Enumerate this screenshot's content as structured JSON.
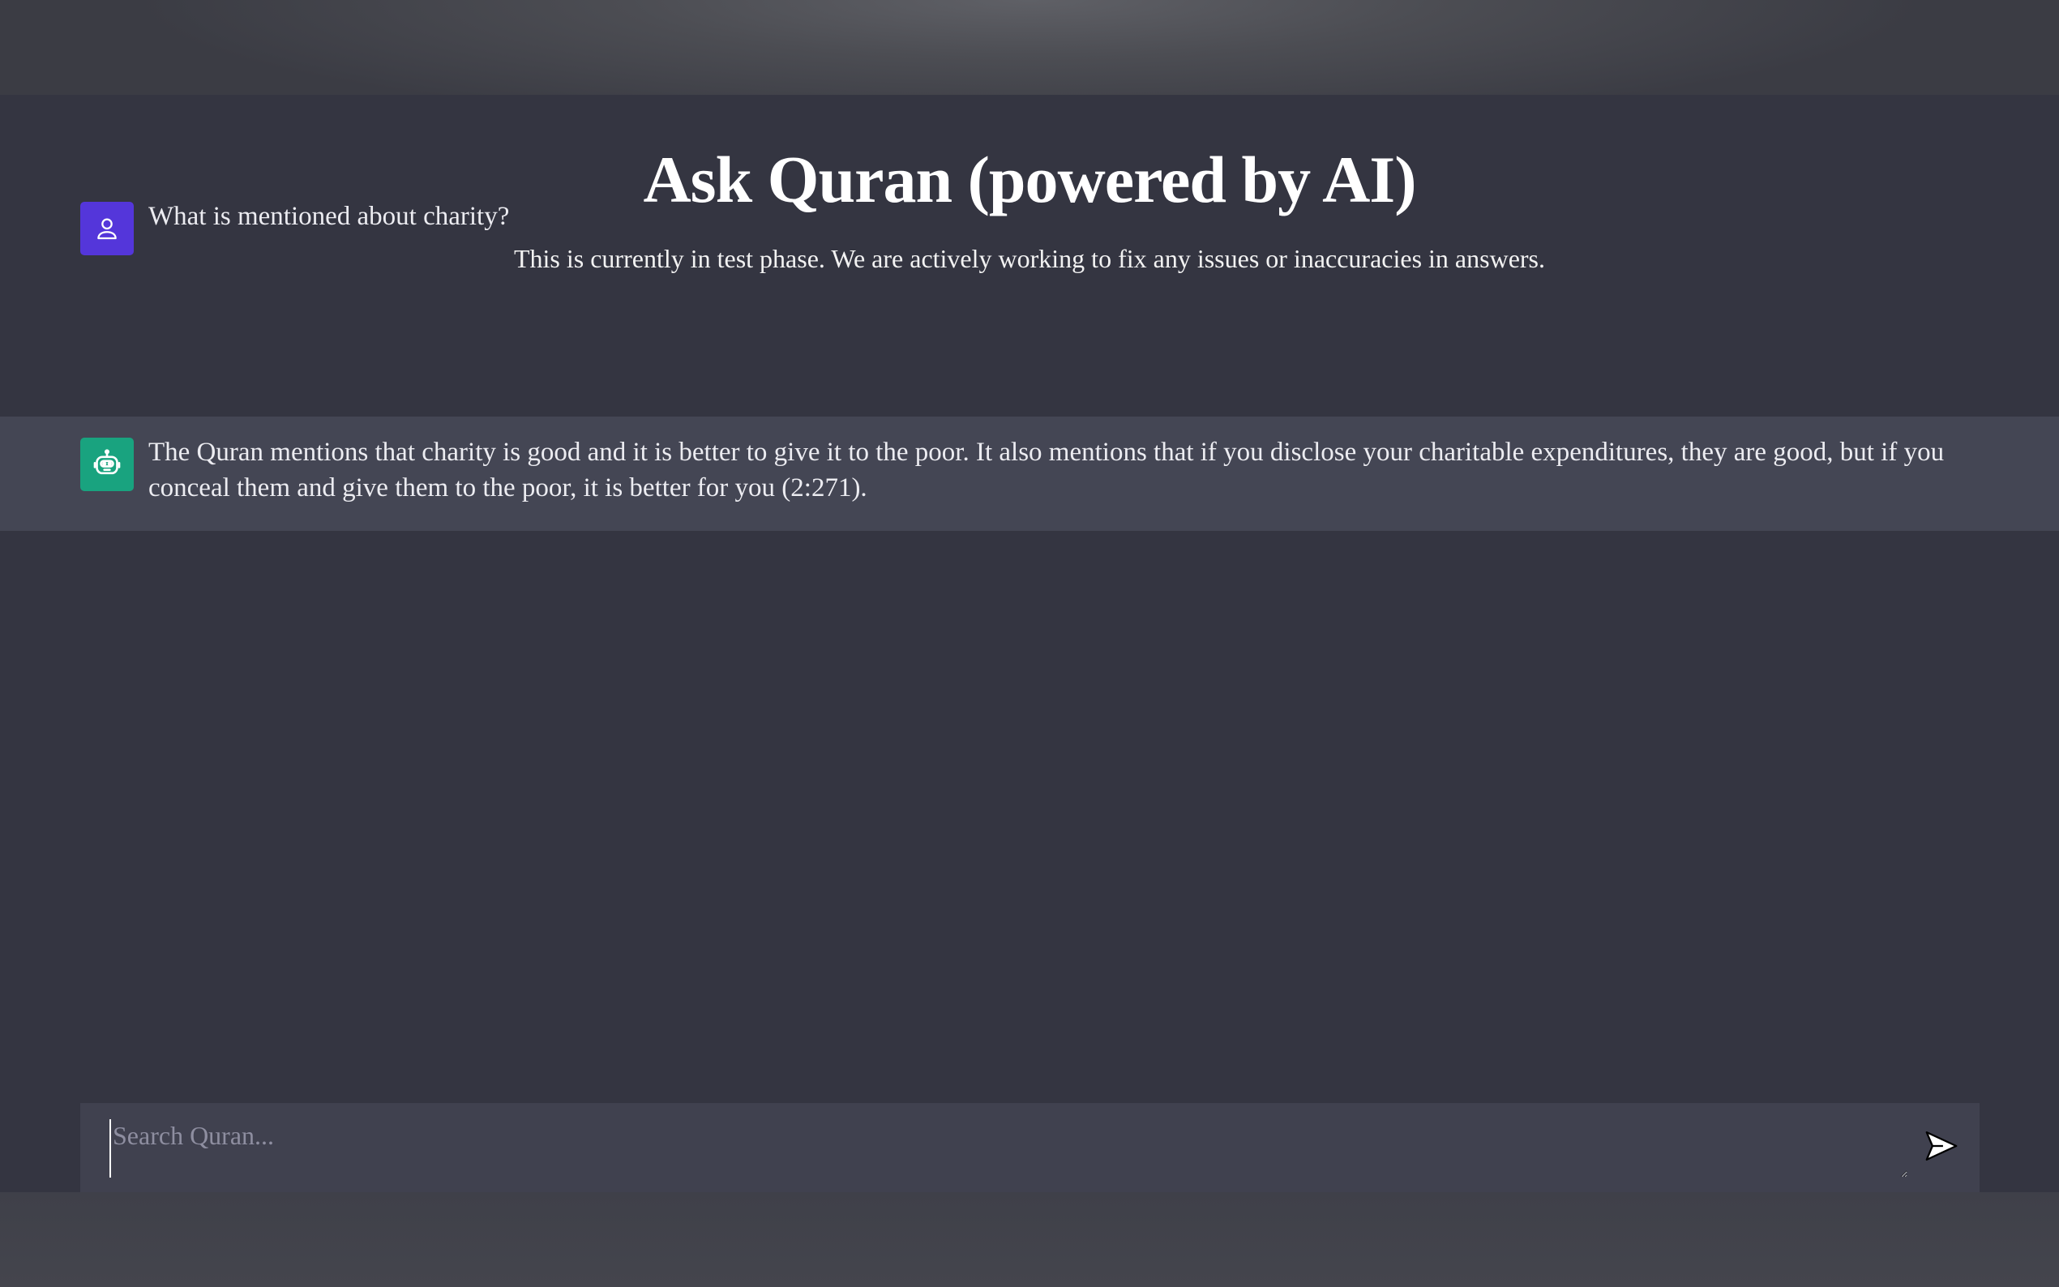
{
  "header": {
    "title": "Ask Quran (powered by AI)",
    "subtitle": "This is currently in test phase. We are actively working to fix any issues or inaccuracies in answers."
  },
  "conversation": {
    "messages": [
      {
        "role": "user",
        "avatar_icon": "user-icon",
        "text": "What is mentioned about charity?"
      },
      {
        "role": "assistant",
        "avatar_icon": "robot-icon",
        "text": " The Quran mentions that charity is good and it is better to give it to the poor. It also mentions that if you disclose your charitable expenditures, they are good, but if you conceal them and give them to the poor, it is better for you (2:271)."
      }
    ]
  },
  "search": {
    "placeholder": "Search Quran...",
    "value": "",
    "send_icon": "send-icon"
  },
  "colors": {
    "background": "#343541",
    "assistant_row": "#444654",
    "input_bg": "#40414f",
    "user_avatar": "#5436da",
    "bot_avatar": "#19a37f"
  }
}
